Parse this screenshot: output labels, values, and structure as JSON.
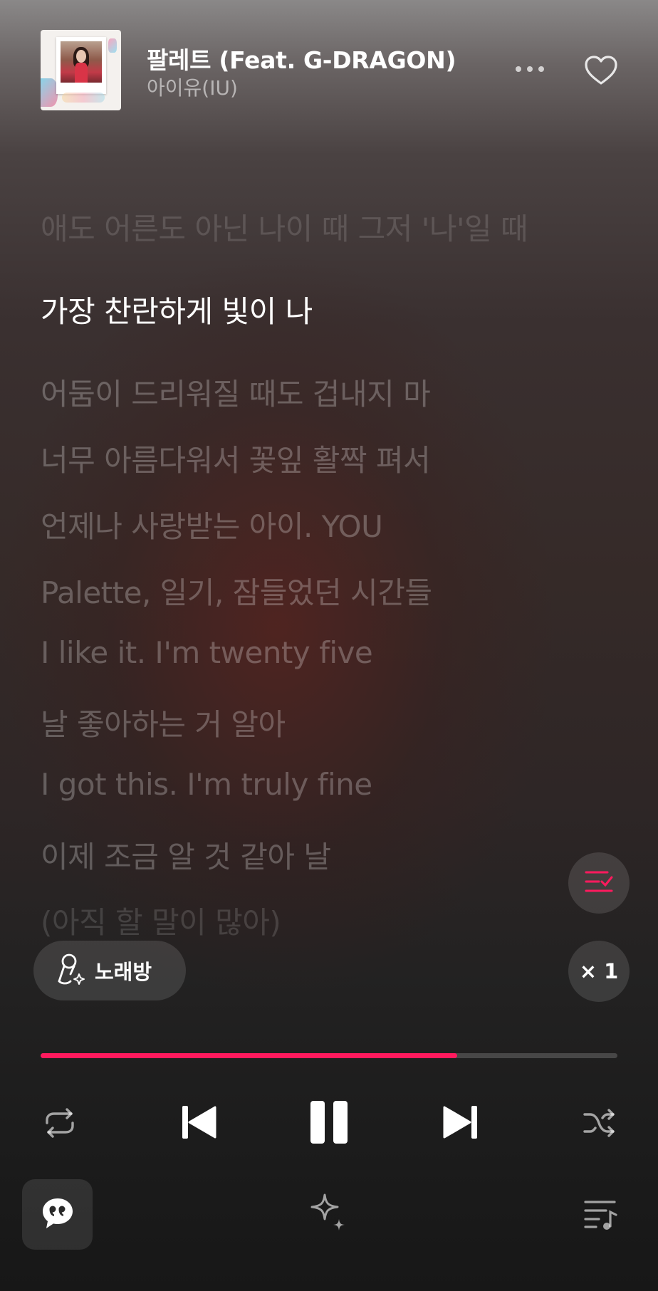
{
  "now_playing": {
    "title": "팔레트 (Feat. G-DRAGON)",
    "artist": "아이유(IU)"
  },
  "header": {
    "more_icon": "more-horizontal-icon",
    "like_icon": "heart-outline-icon"
  },
  "lyrics": {
    "lines": [
      "애도 어른도 아닌 나이 때 그저 '나'일 때",
      "가장 찬란하게 빛이 나",
      "어둠이 드리워질 때도 겁내지 마",
      "너무 아름다워서 꽃잎 활짝 펴서",
      "언제나 사랑받는 아이. YOU",
      "Palette, 일기, 잠들었던 시간들",
      "I like it. I'm twenty five",
      "날 좋아하는 거 알아",
      "I got this. I'm truly fine",
      "이제 조금 알 것 같아 날",
      "(아직 할 말이 많아)"
    ],
    "current_index": 1
  },
  "controls": {
    "karaoke_label": "노래방",
    "speed_label": "× 1",
    "lyrics_select_icon": "list-check-icon",
    "progress_fraction": 0.722,
    "accent_color": "#ff1a5e"
  },
  "playback": {
    "repeat_icon": "repeat-icon",
    "prev_icon": "skip-previous-icon",
    "pause_icon": "pause-icon",
    "next_icon": "skip-next-icon",
    "shuffle_icon": "shuffle-icon"
  },
  "bottom_bar": {
    "lyrics_icon": "quote-bubble-icon",
    "sparkle_icon": "sparkle-icon",
    "playlist_icon": "playlist-music-icon"
  }
}
